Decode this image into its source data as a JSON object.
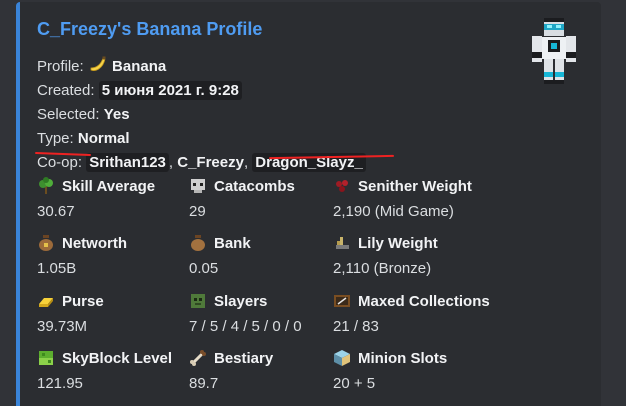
{
  "embed": {
    "accent_color": "#3a84d8",
    "title": "C_Freezy's Banana Profile",
    "thumbnail": "minecraft-skin-avatar",
    "info": {
      "profile_label": "Profile:",
      "profile_icon": "banana-emoji",
      "profile_value": "Banana",
      "created_label": "Created:",
      "created_value": "5 июня 2021 г. 9:28",
      "selected_label": "Selected:",
      "selected_value": "Yes",
      "type_label": "Type:",
      "type_value": "Normal",
      "coop_label": "Co-op:",
      "coop_members": [
        "Srithan123",
        "C_Freezy",
        "Dragon_Slayz_"
      ],
      "coop_separator": ", "
    },
    "fields": [
      {
        "icon": "skill-sapling-icon",
        "name": "Skill Average",
        "value": "30.67"
      },
      {
        "icon": "skull-icon",
        "name": "Catacombs",
        "value": "29"
      },
      {
        "icon": "nether-wart-icon",
        "name": "Senither Weight",
        "value": "2,190 (Mid Game)"
      },
      {
        "icon": "coin-bag-icon",
        "name": "Networth",
        "value": "1.05B"
      },
      {
        "icon": "bank-bag-icon",
        "name": "Bank",
        "value": "0.05"
      },
      {
        "icon": "lily-pad-icon",
        "name": "Lily Weight",
        "value": "2,110 (Bronze)"
      },
      {
        "icon": "gold-ingot-icon",
        "name": "Purse",
        "value": "39.73M"
      },
      {
        "icon": "zombie-head-icon",
        "name": "Slayers",
        "value": "7 / 5 / 4 / 5 / 0 / 0"
      },
      {
        "icon": "painting-icon",
        "name": "Maxed Collections",
        "value": "21 / 83"
      },
      {
        "icon": "skyblock-grass-icon",
        "name": "SkyBlock Level",
        "value": "121.95"
      },
      {
        "icon": "bone-icon",
        "name": "Bestiary",
        "value": "89.7"
      },
      {
        "icon": "minion-block-icon",
        "name": "Minion Slots",
        "value": "20 + 5"
      }
    ]
  }
}
